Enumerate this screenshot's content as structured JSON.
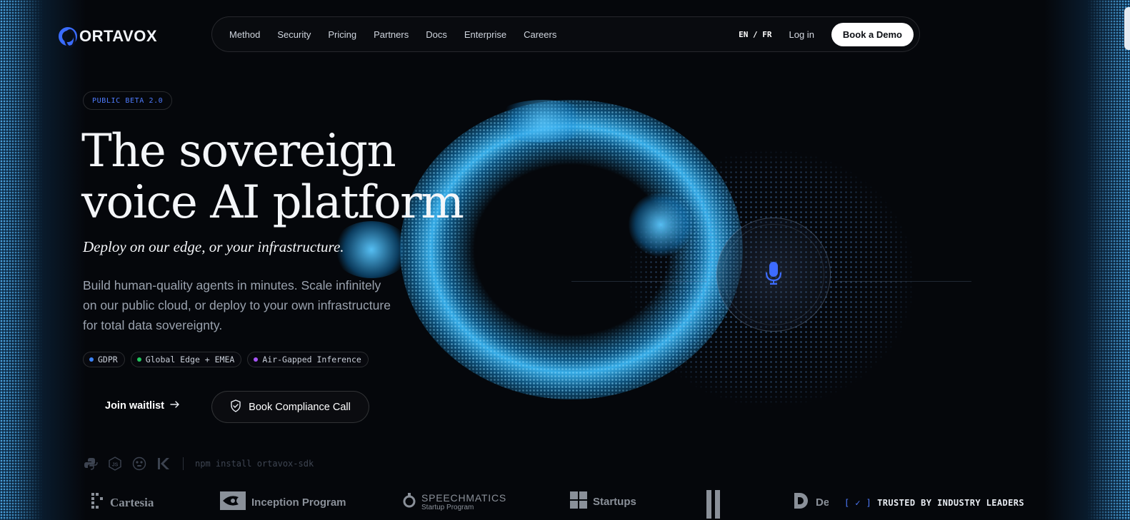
{
  "brand": {
    "name": "ORTAVOX"
  },
  "nav": {
    "links": [
      "Method",
      "Security",
      "Pricing",
      "Partners",
      "Docs",
      "Enterprise",
      "Careers"
    ],
    "lang_en": "EN",
    "lang_sep": "/",
    "lang_fr": "FR",
    "login": "Log in",
    "demo": "Book a Demo"
  },
  "hero": {
    "badge": "PUBLIC BETA 2.0",
    "title_line1": "The sovereign",
    "title_line2": "voice AI platform",
    "subtitle": "Deploy on our edge, or your infrastructure.",
    "description": "Build human-quality agents in minutes. Scale infinitely on our public cloud, or deploy to your own infrastructure for total data sovereignty.",
    "chips": [
      {
        "label": "GDPR",
        "color": "#3b82f6"
      },
      {
        "label": "Global Edge + EMEA",
        "color": "#22c55e"
      },
      {
        "label": "Air-Gapped Inference",
        "color": "#a855f7"
      }
    ],
    "waitlist": "Join waitlist",
    "compliance": "Book Compliance Call"
  },
  "sdk": {
    "icons": [
      "python-icon",
      "nodejs-icon",
      "go-icon",
      "kotlin-icon"
    ],
    "install": "npm install ortavox-sdk"
  },
  "logos": [
    {
      "name": "Cartesia"
    },
    {
      "name": "Inception Program"
    },
    {
      "name": "SPEECHMATICS",
      "sub": "Startup Program"
    },
    {
      "name": "Startups"
    },
    {
      "name": "De"
    }
  ],
  "trusted": {
    "label": "TRUSTED BY INDUSTRY LEADERS",
    "check": "[ ✓ ]"
  },
  "colors": {
    "accent": "#4f7cff",
    "glow": "#3cbcff",
    "background": "#05070b"
  }
}
